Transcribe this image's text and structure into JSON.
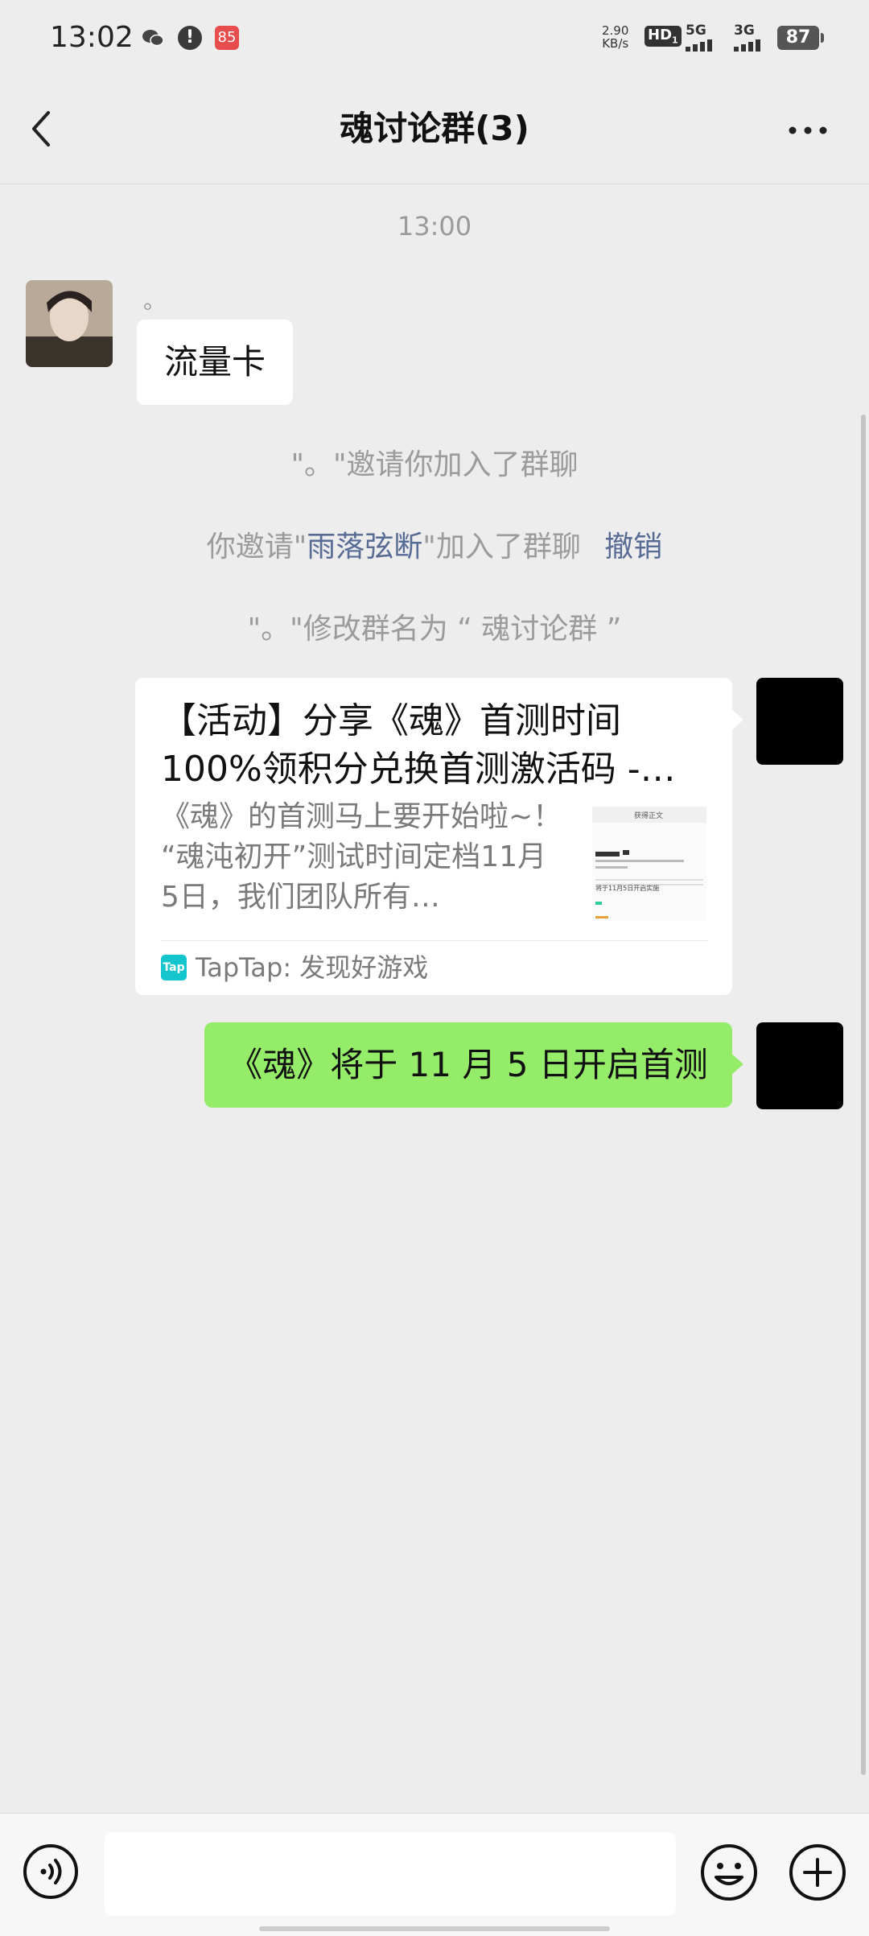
{
  "status_bar": {
    "time": "13:02",
    "net_speed_value": "2.90",
    "net_speed_unit": "KB/s",
    "hd_label": "HD",
    "hd_sub": "1",
    "signal1_label": "5G",
    "signal2_label": "3G",
    "battery": "87",
    "app_icon_text": "85",
    "alert_icon_text": "!"
  },
  "header": {
    "title": "魂讨论群(3)"
  },
  "messages": {
    "timestamp": "13:00",
    "sender_name": "。",
    "incoming_text": "流量卡",
    "system1": "\"。\"邀请你加入了群聊",
    "system2_prefix": "你邀请\"",
    "system2_name": "雨落弦断",
    "system2_suffix": "\"加入了群聊",
    "system2_action": "撤销",
    "system3": "\"。\"修改群名为 “ 魂讨论群 ”",
    "card": {
      "title": "【活动】分享《魂》首测时间100%领积分兑换首测激活码 -…",
      "description": "《魂》的首测马上要开始啦~！ “魂沌初开”测试时间定档11月5日，我们团队所有…",
      "source_logo": "Tap",
      "source": "TapTap: 发现好游戏",
      "thumb_title": "获得正文",
      "thumb_line": "将于11月5日开启实施"
    },
    "outgoing_text": "《魂》将于 11 月 5 日开启首测"
  },
  "input": {
    "placeholder": ""
  },
  "colors": {
    "background": "#ededed",
    "outgoing_bubble": "#95ec69",
    "link": "#576b95",
    "system_text": "#9b9b9b"
  }
}
